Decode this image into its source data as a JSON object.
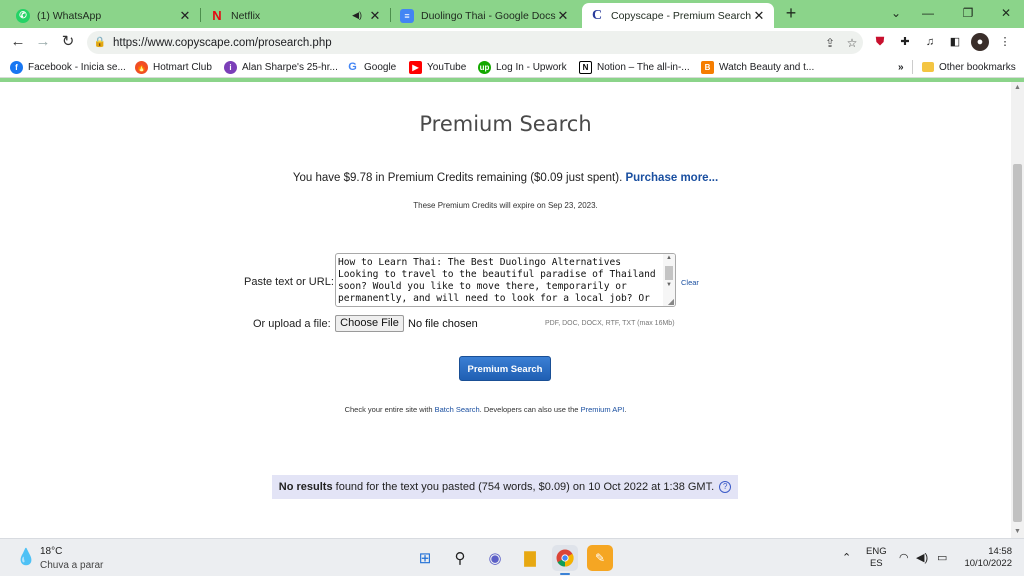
{
  "browser": {
    "tabs": [
      {
        "title": "(1) WhatsApp",
        "icon": "whatsapp-icon"
      },
      {
        "title": "Netflix",
        "icon": "netflix-icon"
      },
      {
        "title": "Duolingo Thai - Google Docs",
        "icon": "google-docs-icon"
      },
      {
        "title": "Copyscape - Premium Search",
        "icon": "copyscape-icon",
        "active": true
      }
    ],
    "new_tab_symbol": "+",
    "url": "https://www.copyscape.com/prosearch.php",
    "bookmarks": [
      {
        "label": "Facebook - Inicia se...",
        "icon": "facebook-icon"
      },
      {
        "label": "Hotmart Club",
        "icon": "hotmart-icon"
      },
      {
        "label": "Alan Sharpe's 25-hr...",
        "icon": "bookmark-purple-icon"
      },
      {
        "label": "Google",
        "icon": "google-icon"
      },
      {
        "label": "YouTube",
        "icon": "youtube-icon"
      },
      {
        "label": "Log In - Upwork",
        "icon": "upwork-icon"
      },
      {
        "label": "Notion – The all-in-...",
        "icon": "notion-icon"
      },
      {
        "label": "Watch Beauty and t...",
        "icon": "blogger-icon"
      }
    ],
    "bookmarks_overflow": "»",
    "other_bookmarks": "Other bookmarks"
  },
  "page": {
    "title": "Premium Search",
    "credits_text": "You have $9.78 in Premium Credits remaining ($0.09 just spent).",
    "purchase_link": "Purchase more...",
    "expire_text": "These Premium Credits will expire on Sep 23, 2023.",
    "paste_label": "Paste text or URL:",
    "pasted_text": "How to Learn Thai: The Best Duolingo Alternatives\nLooking to travel to the beautiful paradise of Thailand soon? Would you like to move there, temporarily or permanently, and will need to look for a local job? Or",
    "clear_link": "Clear",
    "upload_label": "Or upload a file:",
    "choose_file_button": "Choose File",
    "no_file_text": "No file chosen",
    "formats_text": "PDF, DOC, DOCX, RTF, TXT (max 16Mb)",
    "search_button": "Premium Search",
    "batch_prefix": "Check your entire site with",
    "batch_link": "Batch Search",
    "batch_middle": ". Developers can also use the",
    "api_link": "Premium API",
    "batch_suffix": ".",
    "result_bold": "No results",
    "result_text": "found for the text you pasted (754 words, $0.09) on 10 Oct 2022 at 1:38 GMT.",
    "help_symbol": "?"
  },
  "taskbar": {
    "temperature": "18°C",
    "weather": "Chuva a parar",
    "lang_top": "ENG",
    "lang_bottom": "ES",
    "time": "14:58",
    "date": "10/10/2022"
  },
  "colors": {
    "chrome_green": "#8bd48a",
    "link_blue": "#1a4fa0",
    "button_blue": "#1f5fb3",
    "result_bg": "#e3e4f6"
  }
}
